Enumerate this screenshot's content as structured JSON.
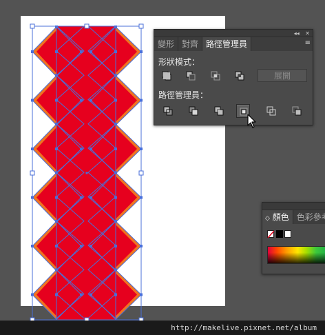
{
  "pathfinder": {
    "titlebar": {
      "collapse_glyph": "◂◂",
      "close_glyph": "✕"
    },
    "tabs": [
      "變形",
      "對齊",
      "路徑管理員"
    ],
    "active_tab": 2,
    "menu_icon": "≡",
    "shape_modes_label": "形狀模式：",
    "shape_mode_icons": [
      "unite-icon",
      "minus-front-icon",
      "intersect-icon",
      "exclude-icon"
    ],
    "expand_label": "展開",
    "pathfinders_label": "路徑管理員：",
    "pathfinder_icons": [
      "divide-icon",
      "trim-icon",
      "merge-icon",
      "crop-icon",
      "outline-icon",
      "minus-back-icon"
    ],
    "pressed_icon": "crop-icon"
  },
  "color_panel": {
    "tabs": [
      "顏色",
      "色彩參考"
    ],
    "tab_arrow": "◇"
  },
  "watermark": "http://makelive.pixnet.net/album",
  "colors": {
    "fill_red": "#e6001e",
    "orange": "#f07320",
    "stroke_blue": "#4a6fd8",
    "panel_bg": "#4a4a4a",
    "app_bg": "#535353"
  }
}
